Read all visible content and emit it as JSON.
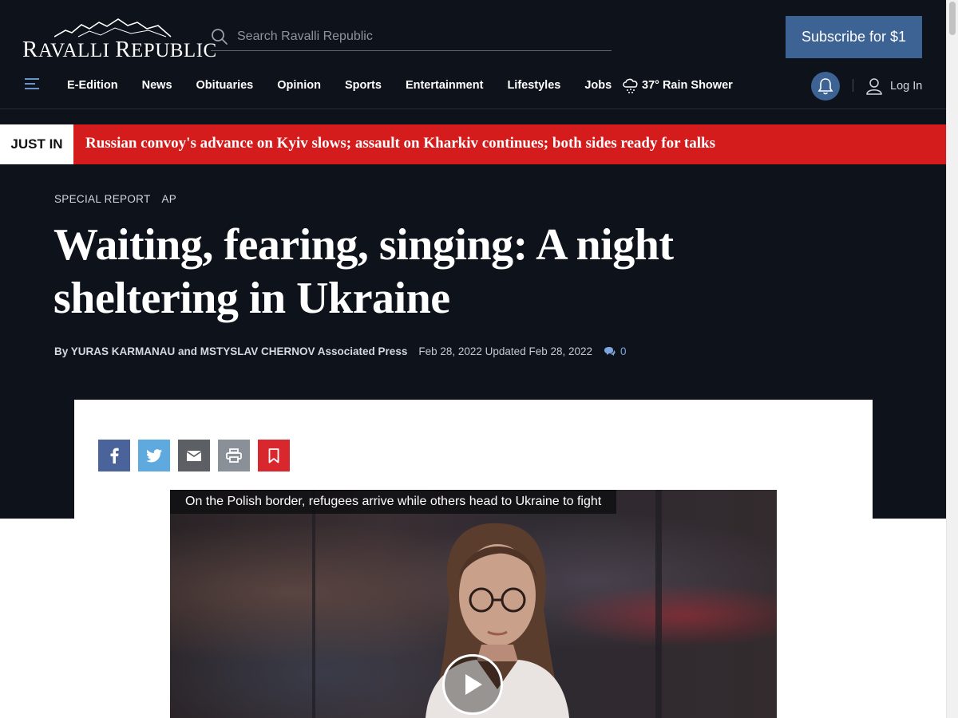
{
  "header": {
    "logo_text": "Ravalli Republic",
    "search_placeholder": "Search Ravalli Republic",
    "subscribe_label": "Subscribe for $1"
  },
  "nav": {
    "items": [
      "E-Edition",
      "News",
      "Obituaries",
      "Opinion",
      "Sports",
      "Entertainment",
      "Lifestyles",
      "Jobs"
    ],
    "weather": "37° Rain Shower",
    "login_label": "Log In"
  },
  "just_in": {
    "label": "JUST IN",
    "headline": "Russian convoy's advance on Kyiv slows; assault on Kharkiv continues; both sides ready for talks"
  },
  "article": {
    "section": "SPECIAL REPORT",
    "source": "AP",
    "headline": "Waiting, fearing, singing: A night sheltering in Ukraine",
    "byline": "By YURAS KARMANAU and MSTYSLAV CHERNOV Associated Press",
    "dates": "Feb 28, 2022 Updated Feb 28, 2022",
    "comment_count": "0"
  },
  "share": {
    "buttons": [
      "facebook-icon",
      "twitter-icon",
      "email-icon",
      "print-icon",
      "bookmark-icon"
    ]
  },
  "video": {
    "caption": "On the Polish border, refugees arrive while others head to Ukraine to fight"
  },
  "colors": {
    "header_bg": "#0d121b",
    "brand_blue": "#3d6294",
    "breaking_red": "#d51c1c",
    "link_blue": "#7ea6dc"
  }
}
